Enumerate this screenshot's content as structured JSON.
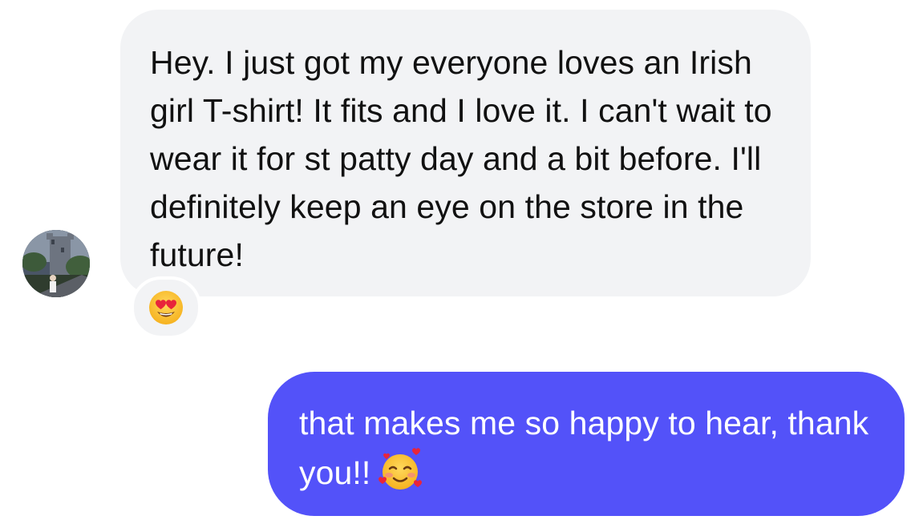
{
  "conversation": {
    "incoming": {
      "text": "Hey. I just got my everyone loves an Irish girl T-shirt! It fits and I love it. I can't wait to wear it for st patty day and a bit before. I'll definitely keep an eye on the store in the future!",
      "reaction": "heart-eyes-emoji"
    },
    "outgoing": {
      "text": "that makes me so happy to hear, thank you!!",
      "emoji": "smiling-face-with-hearts-emoji"
    }
  },
  "colors": {
    "incoming_bubble": "#f2f3f5",
    "outgoing_bubble": "#5352f9",
    "outgoing_text": "#ffffff",
    "incoming_text": "#111111"
  }
}
